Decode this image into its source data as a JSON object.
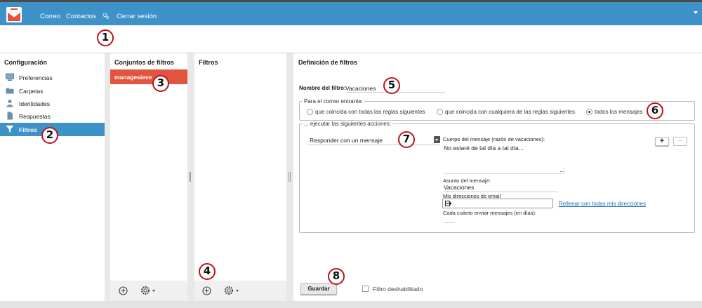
{
  "nav": {
    "items": [
      "Correo",
      "Contactos"
    ],
    "logout": "Cerrar sesión"
  },
  "config": {
    "title": "Configuración",
    "items": [
      {
        "label": "Preferencias",
        "icon": "monitor-icon"
      },
      {
        "label": "Carpetas",
        "icon": "folder-icon"
      },
      {
        "label": "Identidades",
        "icon": "person-icon"
      },
      {
        "label": "Respuestas",
        "icon": "document-icon"
      },
      {
        "label": "Filtros",
        "icon": "funnel-icon",
        "active": true
      }
    ]
  },
  "filter_sets": {
    "title": "Conjuntos de filtros",
    "items": [
      "managesieve"
    ]
  },
  "filters": {
    "title": "Filtros"
  },
  "definition": {
    "title": "Definición de filtros",
    "name_label": "Nombre del filtro:",
    "name_value": "Vacaciones",
    "incoming_legend": "Para el correo entrante:",
    "radios": [
      {
        "label": "que coincida con todas las reglas siguientes",
        "checked": false
      },
      {
        "label": "que coincida con cualquiera de las reglas siguientes",
        "checked": false
      },
      {
        "label": "todos los mensajes",
        "checked": true
      }
    ],
    "actions_legend": "... ejecutar las siguientes acciones:",
    "action_select": "Responder con un mensaje",
    "body_label": "Cuerpo del mensaje (razón de vacaciones):",
    "body_value": "No estaré de tal día a tal día...",
    "add_btn": "+",
    "remove_btn": "−",
    "subject_label": "Asunto del mensaje:",
    "subject_value": "Vacaciones",
    "addresses_label": "Mis direcciones de email",
    "fill_link": "Rellenar con todas mis direcciones",
    "days_label": "Cada cuánto enviar mensajes (en días):",
    "save_btn": "Guardar",
    "disabled_label": "Filtro deshabilitado"
  },
  "badges": [
    "1",
    "2",
    "3",
    "4",
    "5",
    "6",
    "7",
    "8"
  ],
  "colors": {
    "topbar": "#3d92c8",
    "active_item": "#3d92c8",
    "selected_set": "#e15540",
    "badge_ring": "#c0101a",
    "link": "#1a6fb5"
  }
}
